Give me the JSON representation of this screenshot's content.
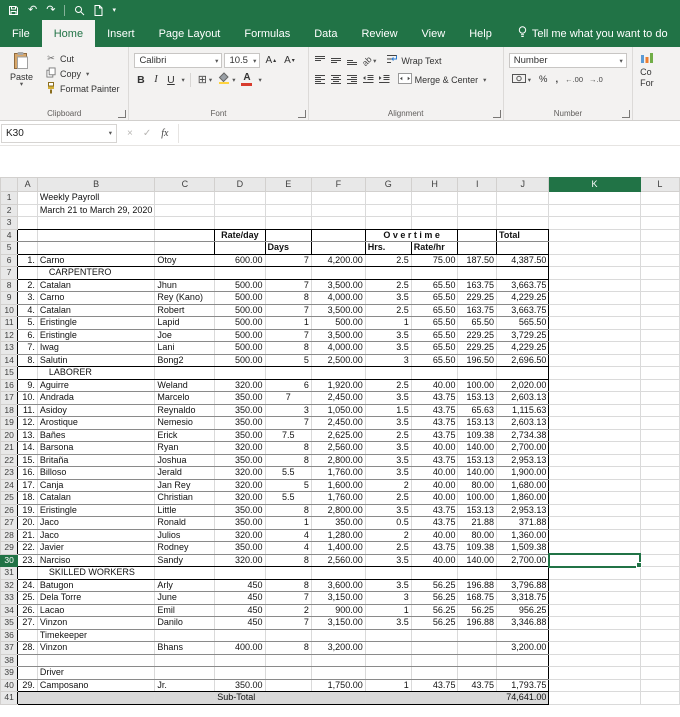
{
  "active_tab": "Home",
  "tabs": [
    "File",
    "Home",
    "Insert",
    "Page Layout",
    "Formulas",
    "Data",
    "Review",
    "View",
    "Help"
  ],
  "tell_me": "Tell me what you want to do",
  "colors": {
    "excel_green": "#217346",
    "selection": "#217346",
    "subtotal_fill": "#d9d9d9"
  },
  "ribbon": {
    "clipboard": {
      "label": "Clipboard",
      "paste": "Paste",
      "cut": "Cut",
      "copy": "Copy",
      "format_painter": "Format Painter"
    },
    "font": {
      "label": "Font",
      "font_name": "Calibri",
      "font_size": "10.5",
      "bold": "B",
      "italic": "I",
      "underline": "U"
    },
    "alignment": {
      "label": "Alignment",
      "wrap_text": "Wrap Text",
      "merge_center": "Merge & Center",
      "orientation": "ab"
    },
    "number": {
      "label": "Number",
      "format": "Number",
      "percent": "%",
      "comma": ",",
      "increase_decimal": "←.00",
      "decrease_decimal": "→.0"
    },
    "styles_clipped": {
      "line1": "Co",
      "line2": "For"
    }
  },
  "formula_bar": {
    "name_box": "K30",
    "cancel": "×",
    "enter": "✓",
    "fx": "fx",
    "value": ""
  },
  "sheet": {
    "columns": [
      "A",
      "B",
      "C",
      "D",
      "E",
      "F",
      "G",
      "H",
      "I",
      "J",
      "K",
      "L"
    ],
    "selected": {
      "cell": "K30",
      "col": "K",
      "row": 30
    },
    "rows": [
      {
        "n": 1,
        "c": {
          "B": "Weekly Payroll"
        }
      },
      {
        "n": 2,
        "c": {
          "B": "March 21 to March 29, 2020"
        }
      },
      {
        "n": 3,
        "c": {}
      },
      {
        "n": 4,
        "c": {
          "D": {
            "v": "Rate/day",
            "b": 1,
            "a": "c"
          },
          "G": {
            "v": "O v e r t i m e",
            "b": 1,
            "a": "c",
            "span": 2
          },
          "J": {
            "v": "Total",
            "b": 1,
            "a": "l"
          }
        }
      },
      {
        "n": 5,
        "c": {
          "E": {
            "v": "Days",
            "b": 1,
            "a": "l"
          },
          "G": {
            "v": "Hrs.",
            "b": 1,
            "a": "l"
          },
          "H": {
            "v": "Rate/hr",
            "b": 1,
            "a": "l"
          }
        }
      },
      {
        "n": 6,
        "c": {
          "A": "1.",
          "B": "Carno",
          "C": "Otoy",
          "D": "600.00",
          "E": "7",
          "F": "4,200.00",
          "G": "2.5",
          "H": "75.00",
          "I": "187.50",
          "J": "4,387.50"
        }
      },
      {
        "n": 7,
        "c": {
          "B": {
            "v": "CARPENTERO",
            "ind": 1
          }
        }
      },
      {
        "n": 8,
        "c": {
          "A": "2.",
          "B": "Catalan",
          "C": "Jhun",
          "D": "500.00",
          "E": "7",
          "F": "3,500.00",
          "G": "2.5",
          "H": "65.50",
          "I": "163.75",
          "J": "3,663.75"
        }
      },
      {
        "n": 9,
        "c": {
          "A": "3.",
          "B": "Carno",
          "C": "Rey (Kano)",
          "D": "500.00",
          "E": "8",
          "F": "4,000.00",
          "G": "3.5",
          "H": "65.50",
          "I": "229.25",
          "J": "4,229.25"
        }
      },
      {
        "n": 10,
        "c": {
          "A": "4.",
          "B": "Catalan",
          "C": "Robert",
          "D": "500.00",
          "E": "7",
          "F": "3,500.00",
          "G": "2.5",
          "H": "65.50",
          "I": "163.75",
          "J": "3,663.75"
        }
      },
      {
        "n": 11,
        "c": {
          "A": "5.",
          "B": "Eristingle",
          "C": "Lapid",
          "D": "500.00",
          "E": "1",
          "F": "500.00",
          "G": "1",
          "H": "65.50",
          "I": "65.50",
          "J": "565.50"
        }
      },
      {
        "n": 12,
        "c": {
          "A": "6.",
          "B": "Eristingle",
          "C": "Joe",
          "D": "500.00",
          "E": "7",
          "F": "3,500.00",
          "G": "3.5",
          "H": "65.50",
          "I": "229.25",
          "J": "3,729.25"
        }
      },
      {
        "n": 13,
        "c": {
          "A": "7.",
          "B": "Iwag",
          "C": "Lani",
          "D": "500.00",
          "E": "8",
          "F": "4,000.00",
          "G": "3.5",
          "H": "65.50",
          "I": "229.25",
          "J": "4,229.25"
        }
      },
      {
        "n": 14,
        "c": {
          "A": "8.",
          "B": "Salutin",
          "C": "Bong2",
          "D": "500.00",
          "E": "5",
          "F": "2,500.00",
          "G": "3",
          "H": "65.50",
          "I": "196.50",
          "J": "2,696.50"
        }
      },
      {
        "n": 15,
        "c": {
          "B": {
            "v": "LABORER",
            "ind": 1
          }
        }
      },
      {
        "n": 16,
        "c": {
          "A": "9.",
          "B": "Aguirre",
          "C": "Weland",
          "D": "320.00",
          "E": "6",
          "F": "1,920.00",
          "G": "2.5",
          "H": "40.00",
          "I": "100.00",
          "J": "2,020.00"
        }
      },
      {
        "n": 17,
        "c": {
          "A": "10.",
          "B": "Andrada",
          "C": "Marcelo",
          "D": "350.00",
          "E": {
            "v": "7",
            "a": "c"
          },
          "F": "2,450.00",
          "G": "3.5",
          "H": "43.75",
          "I": "153.13",
          "J": "2,603.13"
        }
      },
      {
        "n": 18,
        "c": {
          "A": "11.",
          "B": "Asidoy",
          "C": "Reynaldo",
          "D": "350.00",
          "E": "3",
          "F": "1,050.00",
          "G": "1.5",
          "H": "43.75",
          "I": "65.63",
          "J": "1,115.63"
        }
      },
      {
        "n": 19,
        "c": {
          "A": "12.",
          "B": "Arostique",
          "C": "Nemesio",
          "D": "350.00",
          "E": "7",
          "F": "2,450.00",
          "G": "3.5",
          "H": "43.75",
          "I": "153.13",
          "J": "2,603.13"
        }
      },
      {
        "n": 20,
        "c": {
          "A": "13.",
          "B": "Bañes",
          "C": "Erick",
          "D": "350.00",
          "E": {
            "v": "7.5",
            "a": "c"
          },
          "F": "2,625.00",
          "G": "2.5",
          "H": "43.75",
          "I": "109.38",
          "J": "2,734.38"
        }
      },
      {
        "n": 21,
        "c": {
          "A": "14.",
          "B": "Barsona",
          "C": "Ryan",
          "D": "320.00",
          "E": "8",
          "F": "2,560.00",
          "G": "3.5",
          "H": "40.00",
          "I": "140.00",
          "J": "2,700.00"
        }
      },
      {
        "n": 22,
        "c": {
          "A": "15.",
          "B": "Britaña",
          "C": "Joshua",
          "D": "350.00",
          "E": "8",
          "F": "2,800.00",
          "G": "3.5",
          "H": "43.75",
          "I": "153.13",
          "J": "2,953.13"
        }
      },
      {
        "n": 23,
        "c": {
          "A": "16.",
          "B": "Billoso",
          "C": "Jerald",
          "D": "320.00",
          "E": {
            "v": "5.5",
            "a": "c"
          },
          "F": "1,760.00",
          "G": "3.5",
          "H": "40.00",
          "I": "140.00",
          "J": "1,900.00"
        }
      },
      {
        "n": 24,
        "c": {
          "A": "17.",
          "B": "Canja",
          "C": "Jan Rey",
          "D": "320.00",
          "E": "5",
          "F": "1,600.00",
          "G": "2",
          "H": "40.00",
          "I": "80.00",
          "J": "1,680.00"
        }
      },
      {
        "n": 25,
        "c": {
          "A": "18.",
          "B": "Catalan",
          "C": "Christian",
          "D": "320.00",
          "E": {
            "v": "5.5",
            "a": "c"
          },
          "F": "1,760.00",
          "G": "2.5",
          "H": "40.00",
          "I": "100.00",
          "J": "1,860.00"
        }
      },
      {
        "n": 26,
        "c": {
          "A": "19.",
          "B": "Eristingle",
          "C": "Little",
          "D": "350.00",
          "E": "8",
          "F": "2,800.00",
          "G": "3.5",
          "H": "43.75",
          "I": "153.13",
          "J": "2,953.13"
        }
      },
      {
        "n": 27,
        "c": {
          "A": "20.",
          "B": "Jaco",
          "C": "Ronald",
          "D": "350.00",
          "E": "1",
          "F": "350.00",
          "G": "0.5",
          "H": "43.75",
          "I": "21.88",
          "J": "371.88"
        }
      },
      {
        "n": 28,
        "c": {
          "A": "21.",
          "B": "Jaco",
          "C": "Julios",
          "D": "320.00",
          "E": "4",
          "F": "1,280.00",
          "G": "2",
          "H": "40.00",
          "I": "80.00",
          "J": "1,360.00"
        }
      },
      {
        "n": 29,
        "c": {
          "A": "22.",
          "B": "Javier",
          "C": "Rodney",
          "D": "350.00",
          "E": "4",
          "F": "1,400.00",
          "G": "2.5",
          "H": "43.75",
          "I": "109.38",
          "J": "1,509.38"
        }
      },
      {
        "n": 30,
        "c": {
          "A": "23.",
          "B": "Narciso",
          "C": "Sandy",
          "D": "320.00",
          "E": "8",
          "F": "2,560.00",
          "G": "3.5",
          "H": "40.00",
          "I": "140.00",
          "J": "2,700.00"
        }
      },
      {
        "n": 31,
        "c": {
          "B": {
            "v": "SKILLED WORKERS",
            "ind": 1
          }
        }
      },
      {
        "n": 32,
        "c": {
          "A": "24.",
          "B": "Batugon",
          "C": "Arly",
          "D": "450",
          "E": "8",
          "F": "3,600.00",
          "G": "3.5",
          "H": "56.25",
          "I": "196.88",
          "J": "3,796.88"
        }
      },
      {
        "n": 33,
        "c": {
          "A": "25.",
          "B": "Dela Torre",
          "C": "June",
          "D": "450",
          "E": "7",
          "F": "3,150.00",
          "G": "3",
          "H": "56.25",
          "I": "168.75",
          "J": "3,318.75"
        }
      },
      {
        "n": 34,
        "c": {
          "A": "26.",
          "B": "Lacao",
          "C": "Emil",
          "D": "450",
          "E": "2",
          "F": "900.00",
          "G": "1",
          "H": "56.25",
          "I": "56.25",
          "J": "956.25"
        }
      },
      {
        "n": 35,
        "c": {
          "A": "27.",
          "B": "Vinzon",
          "C": "Danilo",
          "D": "450",
          "E": "7",
          "F": "3,150.00",
          "G": "3.5",
          "H": "56.25",
          "I": "196.88",
          "J": "3,346.88"
        }
      },
      {
        "n": 36,
        "c": {
          "B": "Timekeeper"
        }
      },
      {
        "n": 37,
        "c": {
          "A": "28.",
          "B": "Vinzon",
          "C": "Bhans",
          "D": "400.00",
          "E": "8",
          "F": "3,200.00",
          "J": "3,200.00"
        }
      },
      {
        "n": 38,
        "c": {}
      },
      {
        "n": 39,
        "c": {
          "B": "Driver"
        }
      },
      {
        "n": 40,
        "c": {
          "A": "29.",
          "B": "Camposano",
          "C": "Jr.",
          "D": "350.00",
          "F": "1,750.00",
          "G": "1",
          "H": "43.75",
          "I": "43.75",
          "J": "1,793.75"
        }
      },
      {
        "n": 41,
        "c": {
          "D": {
            "v": "Sub-Total",
            "a": "l"
          },
          "J": "74,641.00"
        }
      }
    ]
  }
}
